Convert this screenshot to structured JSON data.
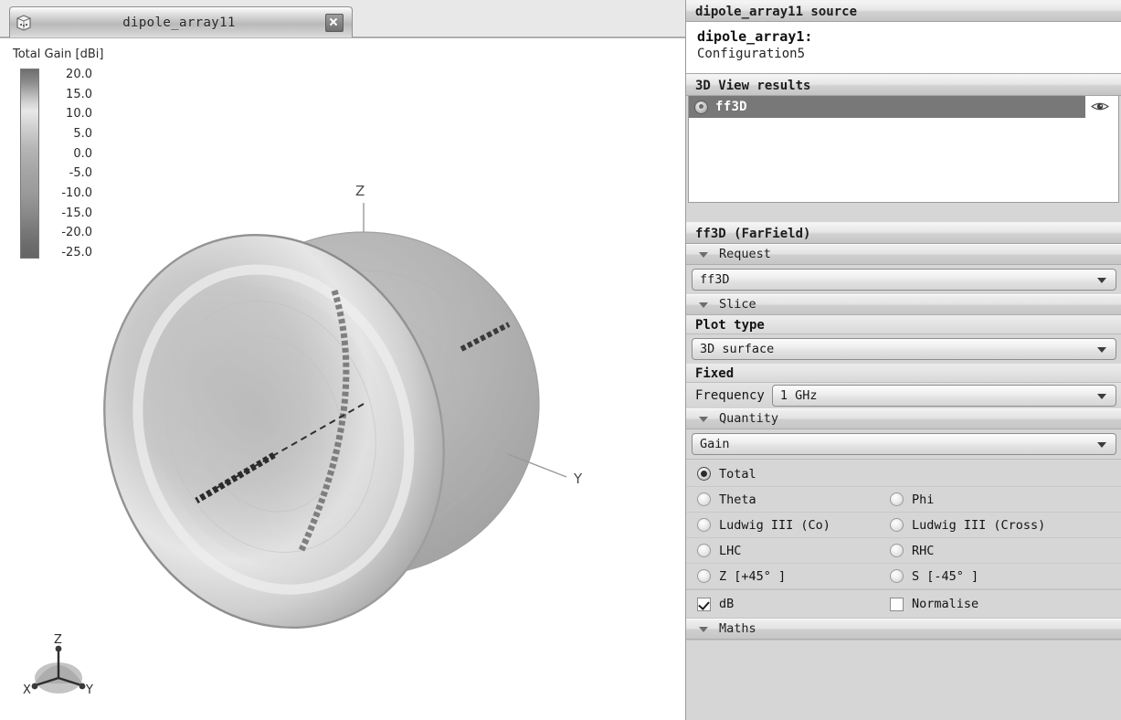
{
  "window": {
    "tab": {
      "title": "dipole_array11",
      "doc_icon": "3d-view-icon",
      "close_icon": "close-icon"
    }
  },
  "legend": {
    "title": "Total Gain [dBi]",
    "ticks": [
      "20.0",
      "15.0",
      "10.0",
      "5.0",
      "0.0",
      "-5.0",
      "-10.0",
      "-15.0",
      "-20.0",
      "-25.0"
    ],
    "max": 20.0,
    "min": -25.0,
    "step": 5.0
  },
  "plot": {
    "axis_z": "Z",
    "axis_y": "Y",
    "triad": {
      "x": "X",
      "y": "Y",
      "z": "Z"
    }
  },
  "panel": {
    "source_header": "dipole_array11 source",
    "source_name": "dipole_array1:",
    "source_config": "Configuration5",
    "results_header": "3D View results",
    "results": [
      {
        "label": "ff3D",
        "selected": true,
        "visible_icon": "eye-icon",
        "type_icon": "farfield-icon"
      }
    ],
    "properties_header": "ff3D (FarField)",
    "groups": {
      "request": {
        "label": "Request",
        "expanded": true,
        "value": "ff3D"
      },
      "slice": {
        "label": "Slice",
        "expanded": true,
        "plot_type_label": "Plot type",
        "plot_type_value": "3D surface",
        "fixed_label": "Fixed",
        "frequency_label": "Frequency",
        "frequency_value": "1 GHz"
      },
      "quantity": {
        "label": "Quantity",
        "expanded": true,
        "value": "Gain",
        "components": [
          {
            "label": "Total",
            "selected": true,
            "column": 1
          },
          {
            "label": "Theta",
            "selected": false,
            "column": 1
          },
          {
            "label": "Phi",
            "selected": false,
            "column": 2
          },
          {
            "label": "Ludwig III (Co)",
            "selected": false,
            "column": 1
          },
          {
            "label": "Ludwig III (Cross)",
            "selected": false,
            "column": 2
          },
          {
            "label": "LHC",
            "selected": false,
            "column": 1
          },
          {
            "label": "RHC",
            "selected": false,
            "column": 2
          },
          {
            "label": "Z [+45° ]",
            "selected": false,
            "column": 1
          },
          {
            "label": "S [-45° ]",
            "selected": false,
            "column": 2
          }
        ],
        "checkboxes": [
          {
            "label": "dB",
            "checked": true
          },
          {
            "label": "Normalise",
            "checked": false
          }
        ]
      },
      "maths": {
        "label": "Maths",
        "expanded": true
      }
    }
  },
  "colors": {
    "panel_bg": "#d6d6d6",
    "selection": "#787878",
    "view_bg": "#ffffff",
    "header_text": "#1d1d1d"
  }
}
